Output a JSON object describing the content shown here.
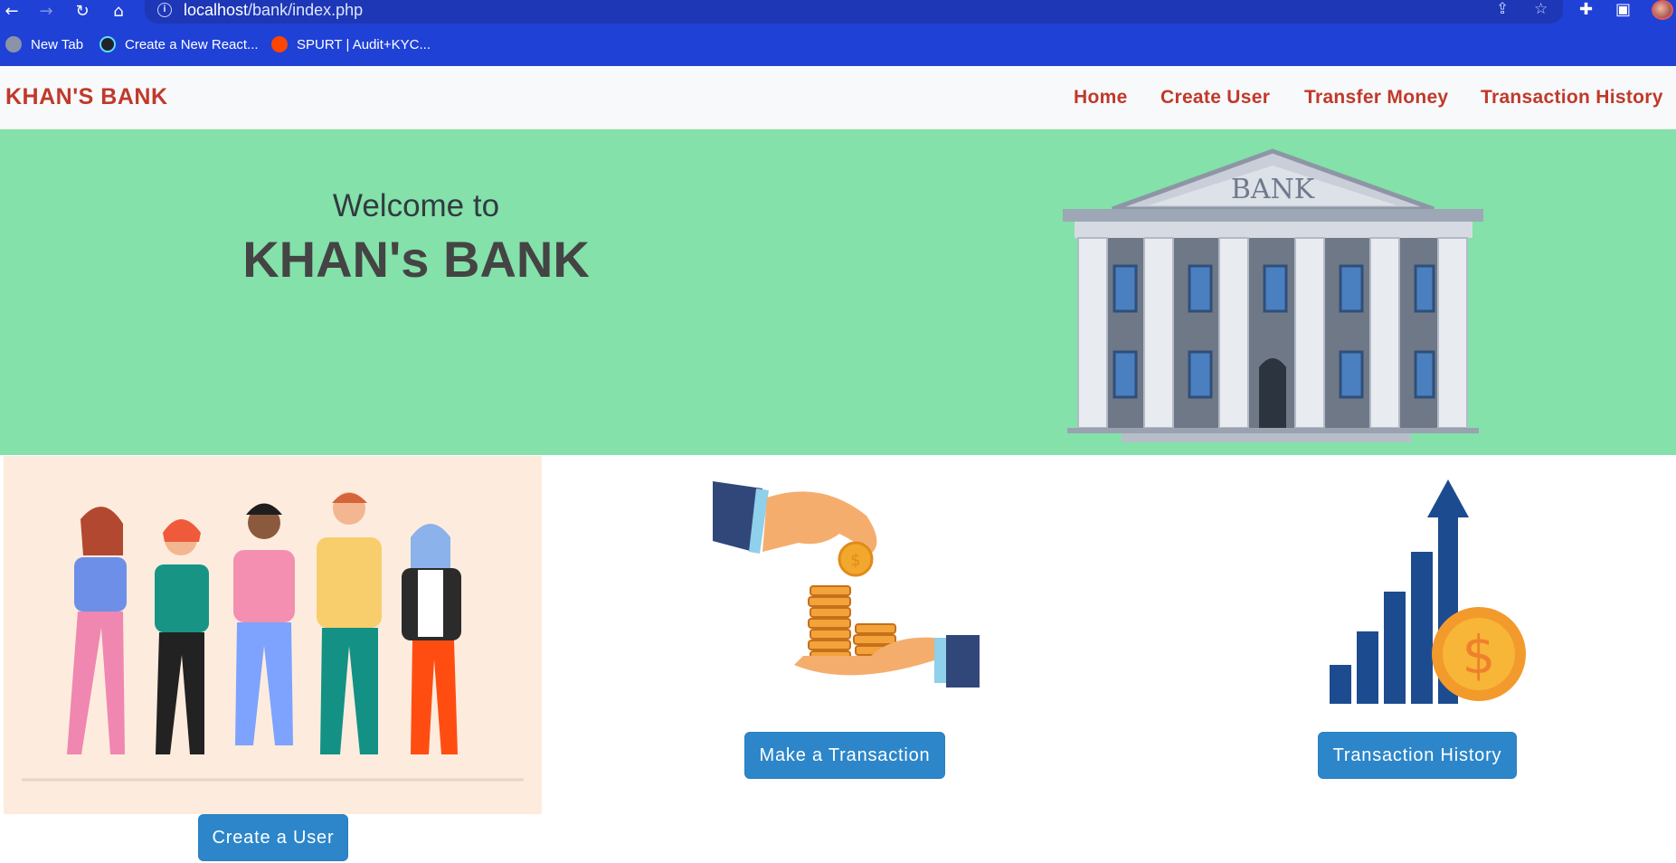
{
  "browser": {
    "url_host": "localhost",
    "url_path": "/bank/index.php",
    "bookmarks": [
      {
        "label": "New Tab",
        "icon": "globe-icon"
      },
      {
        "label": "Create a New React...",
        "icon": "react-icon"
      },
      {
        "label": "SPURT | Audit+KYC...",
        "icon": "reddit-icon"
      }
    ]
  },
  "nav": {
    "brand": "KHAN'S BANK",
    "links": [
      "Home",
      "Create User",
      "Transfer Money",
      "Transaction History"
    ]
  },
  "hero": {
    "welcome": "Welcome to",
    "title": "KHAN's BANK",
    "building_sign": "BANK"
  },
  "cards": {
    "create_user_button": "Create a User",
    "transaction_button": "Make a Transaction",
    "history_button": "Transaction History"
  },
  "colors": {
    "chrome": "#1f41d6",
    "brand_red": "#c0392b",
    "hero_green": "#83e1a9",
    "button_blue": "#2c86c9"
  }
}
